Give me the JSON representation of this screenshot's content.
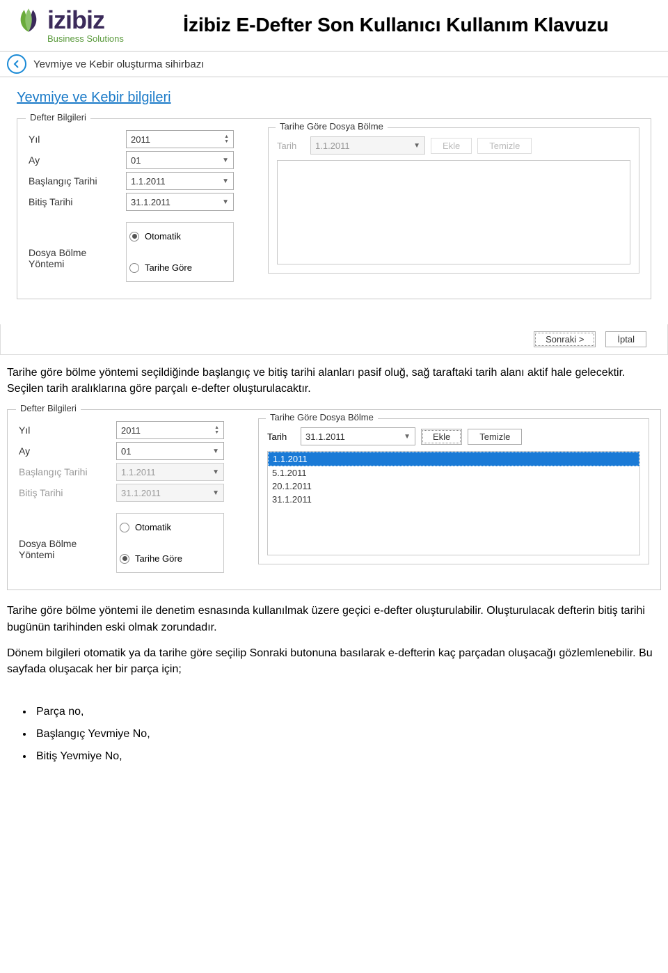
{
  "header": {
    "logo_text": "izibiz",
    "logo_sub": "Business Solutions",
    "doc_title": "İzibiz E-Defter Son Kullanıcı Kullanım Klavuzu"
  },
  "wizard_bar": {
    "title": "Yevmiye ve Kebir oluşturma sihirbazı"
  },
  "panel1": {
    "section_title": "Yevmiye ve Kebir bilgileri",
    "legend": "Defter Bilgileri",
    "labels": {
      "yil": "Yıl",
      "ay": "Ay",
      "baslangic": "Başlangıç Tarihi",
      "bitis": "Bitiş Tarihi",
      "bolme": "Dosya Bölme Yöntemi"
    },
    "values": {
      "yil": "2011",
      "ay": "01",
      "baslangic": "1.1.2011",
      "bitis": "31.1.2011"
    },
    "radios": {
      "otomatik": "Otomatik",
      "tarihe_gore": "Tarihe Göre"
    },
    "inner": {
      "legend": "Tarihe Göre Dosya Bölme",
      "tarih_label": "Tarih",
      "tarih_value": "1.1.2011",
      "ekle": "Ekle",
      "temizle": "Temizle"
    }
  },
  "footer": {
    "sonraki": "Sonraki >",
    "iptal": "İptal"
  },
  "para1": "Tarihe göre bölme yöntemi seçildiğinde başlangıç ve bitiş tarihi alanları pasif oluğ, sağ taraftaki tarih alanı aktif hale gelecektir. Seçilen tarih aralıklarına göre parçalı e-defter oluşturulacaktır.",
  "panel2": {
    "legend": "Defter Bilgileri",
    "labels": {
      "yil": "Yıl",
      "ay": "Ay",
      "baslangic": "Başlangıç Tarihi",
      "bitis": "Bitiş Tarihi",
      "bolme": "Dosya Bölme Yöntemi"
    },
    "values": {
      "yil": "2011",
      "ay": "01",
      "baslangic": "1.1.2011",
      "bitis": "31.1.2011"
    },
    "radios": {
      "otomatik": "Otomatik",
      "tarihe_gore": "Tarihe Göre"
    },
    "inner": {
      "legend": "Tarihe Göre Dosya Bölme",
      "tarih_label": "Tarih",
      "tarih_value": "31.1.2011",
      "ekle": "Ekle",
      "temizle": "Temizle",
      "list": [
        "1.1.2011",
        "5.1.2011",
        "20.1.2011",
        "31.1.2011"
      ]
    }
  },
  "para2": "Tarihe göre bölme yöntemi ile denetim esnasında kullanılmak üzere geçici e-defter oluşturulabilir. Oluşturulacak defterin bitiş tarihi bugünün tarihinden eski olmak zorundadır.",
  "para3": "Dönem bilgileri otomatik ya da tarihe göre seçilip Sonraki butonuna basılarak e-defterin kaç parçadan oluşacağı gözlemlenebilir. Bu sayfada oluşacak her bir parça için;",
  "bullets": [
    "Parça no,",
    "Başlangıç Yevmiye No,",
    "Bitiş Yevmiye No,"
  ]
}
